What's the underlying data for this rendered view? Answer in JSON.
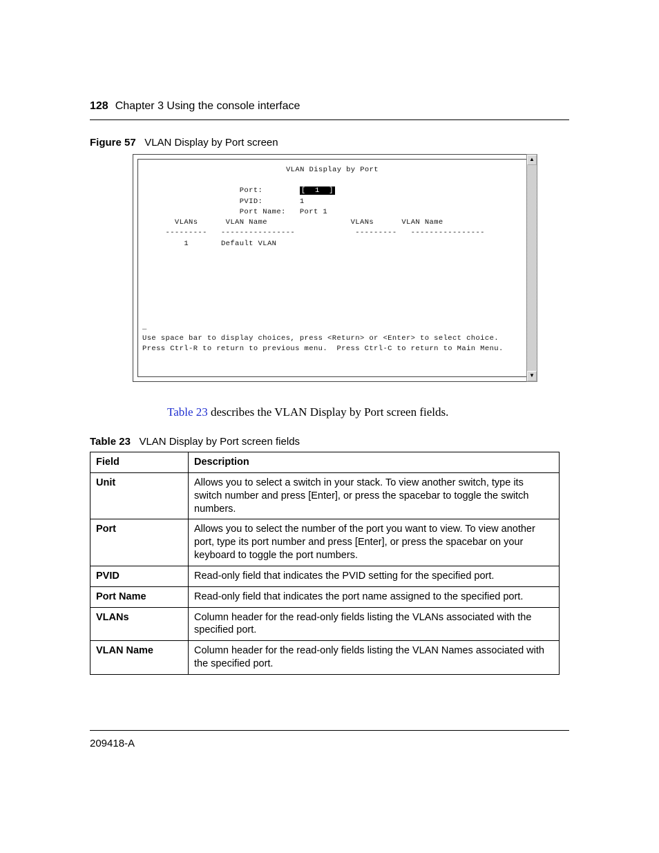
{
  "header": {
    "page_number": "128",
    "chapter": "Chapter 3  Using the console interface"
  },
  "figure": {
    "label": "Figure 57",
    "title": "VLAN Display by Port screen"
  },
  "console": {
    "title": "VLAN Display by Port",
    "port_label": "Port:",
    "port_value": "[  1  ]",
    "pvid_label": "PVID:",
    "pvid_value": "1",
    "portname_label": "Port Name:",
    "portname_value": "Port 1",
    "col_vlans": "VLANs",
    "col_vlanname": "VLAN Name",
    "row1_vlan": "1",
    "row1_name": "Default VLAN",
    "hint1": "Use space bar to display choices, press <Return> or <Enter> to select choice.",
    "hint2": "Press Ctrl-R to return to previous menu.  Press Ctrl-C to return to Main Menu."
  },
  "body": {
    "xref": "Table 23",
    "rest": " describes the VLAN Display by Port screen fields."
  },
  "table": {
    "label": "Table 23",
    "title": "VLAN Display by Port screen fields",
    "head_field": "Field",
    "head_desc": "Description",
    "rows": [
      {
        "field": "Unit",
        "desc": "Allows you to select a switch in your stack. To view another switch, type its switch number and press [Enter], or press the spacebar to toggle the switch numbers."
      },
      {
        "field": "Port",
        "desc": "Allows you to select the number of the port you want to view. To view another port, type its port number and press [Enter], or press the spacebar on your keyboard to toggle the port numbers."
      },
      {
        "field": "PVID",
        "desc": "Read-only field that indicates the PVID setting for the specified port."
      },
      {
        "field": "Port Name",
        "desc": "Read-only field that indicates the port name assigned to the specified port."
      },
      {
        "field": "VLANs",
        "desc": "Column header for the read-only fields listing the VLANs associated with the specified port."
      },
      {
        "field": "VLAN Name",
        "desc": "Column header for the read-only fields listing the VLAN Names associated with the specified port."
      }
    ]
  },
  "footer": {
    "doc_id": "209418-A"
  }
}
